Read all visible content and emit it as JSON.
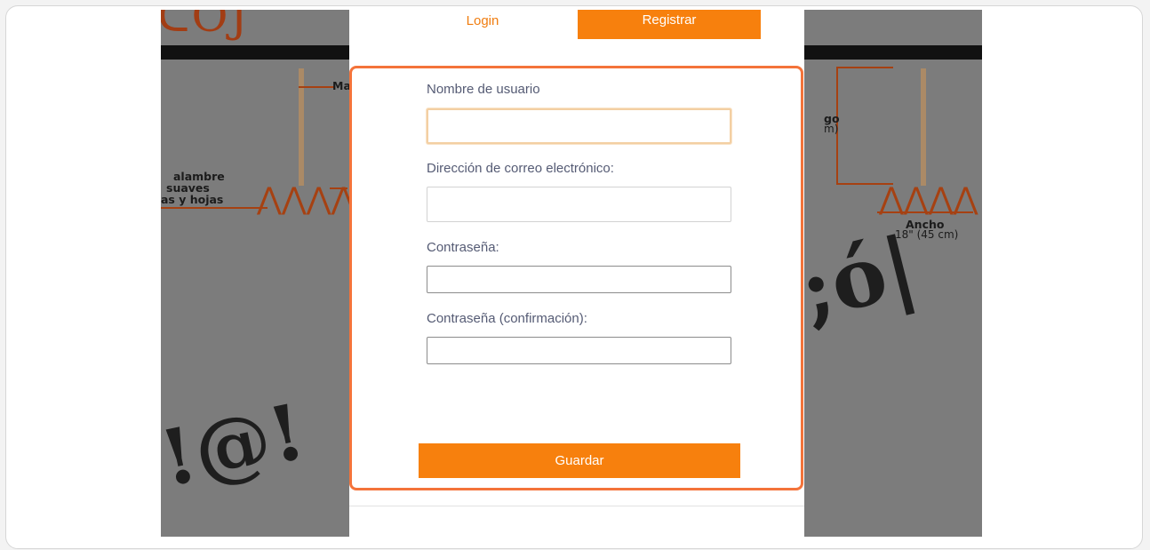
{
  "tabs": {
    "login_label": "Login",
    "register_label": "Registrar"
  },
  "form": {
    "username_label": "Nombre de usuario",
    "username_value": "",
    "email_label": "Dirección de correo electrónico:",
    "email_value": "",
    "password_label": "Contraseña:",
    "password_value": "",
    "password_confirm_label": "Contraseña (confirmación):",
    "password_confirm_value": "",
    "save_label": "Guardar"
  },
  "background": {
    "label_left_1": "alambre",
    "label_left_2": "suaves",
    "label_left_3": "as y hojas",
    "label_top_left": "Ma",
    "label_right_1": "go",
    "label_right_2": "m)",
    "label_width": "Ancho",
    "label_width_measure": "18\" (45 cm)"
  },
  "colors": {
    "accent": "#f7800d",
    "panel_border": "#f4733a",
    "label_text": "#555b74"
  }
}
